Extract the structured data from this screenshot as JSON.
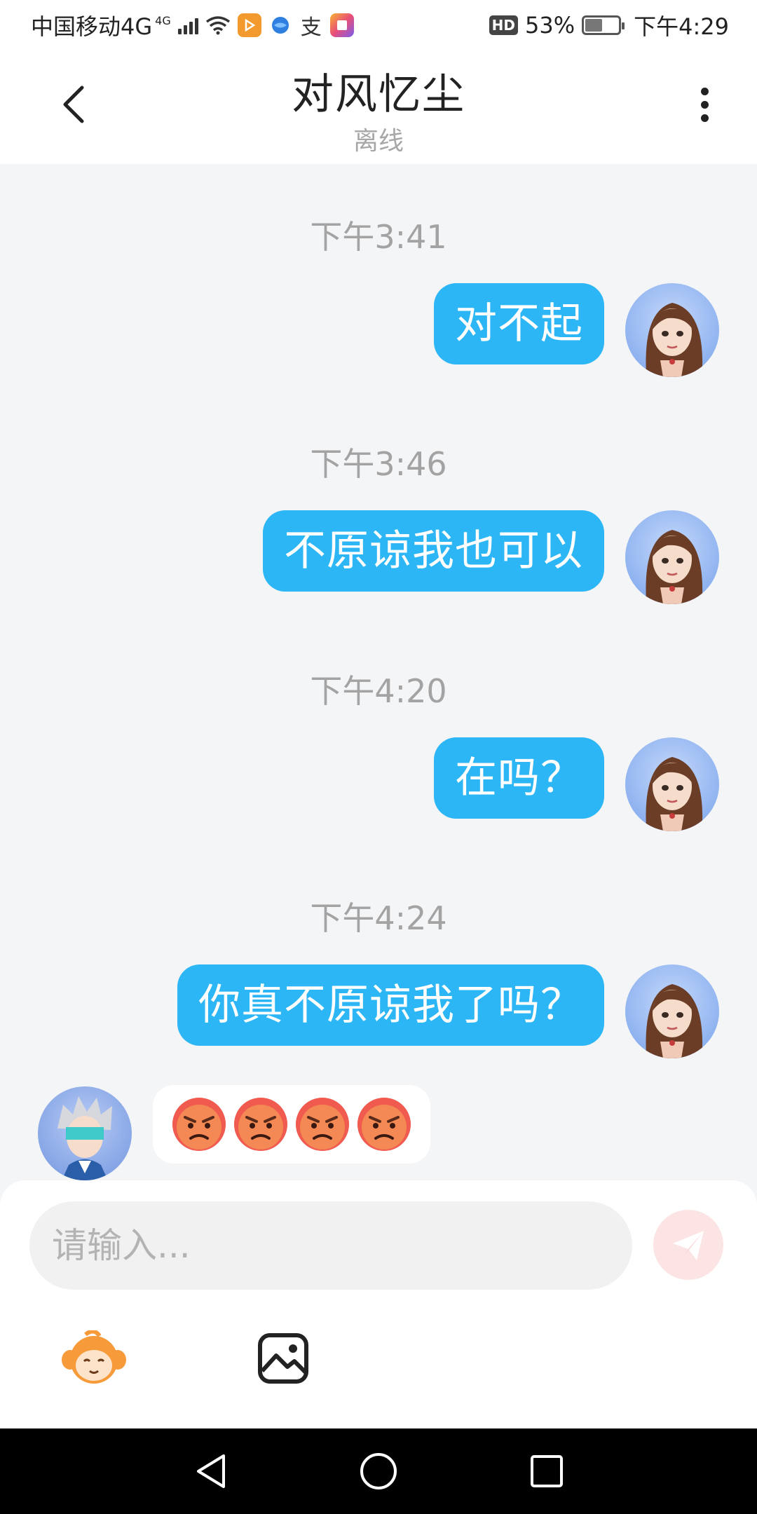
{
  "status_bar": {
    "carrier": "中国移动4G",
    "network_sup": "4G",
    "hd": "HD",
    "battery_percent": "53%",
    "battery_level": 0.53,
    "time": "下午4:29",
    "pay_icon_char": "支"
  },
  "header": {
    "title": "对风忆尘",
    "status": "离线"
  },
  "messages": [
    {
      "time": "下午3:41",
      "text": "对不起"
    },
    {
      "time": "下午3:46",
      "text": "不原谅我也可以"
    },
    {
      "time": "下午4:20",
      "text": "在吗？"
    },
    {
      "time": "下午4:24",
      "text": "你真不原谅我了吗？"
    }
  ],
  "reply": {
    "emoji": [
      "angry-face",
      "angry-face",
      "angry-face",
      "angry-face"
    ]
  },
  "input": {
    "placeholder": "请输入..."
  },
  "colors": {
    "bubble": "#2db6f5",
    "send_button": "#fde4e4",
    "background": "#f4f5f7"
  }
}
